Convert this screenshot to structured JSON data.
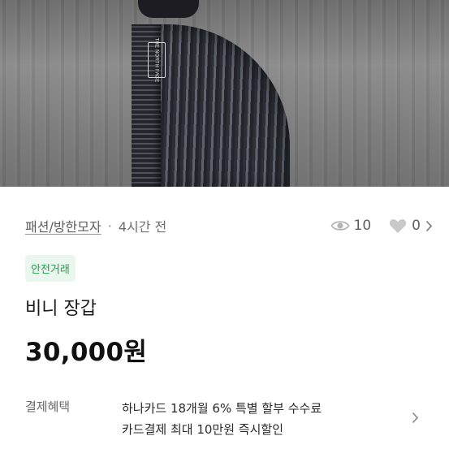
{
  "photo": {
    "logo_text": "THE NORTH FACE"
  },
  "meta": {
    "category": "패션/방한모자",
    "separator": "·",
    "time_ago": "4시간 전",
    "views": "10",
    "likes": "0",
    "icons": {
      "views": "eye-icon",
      "likes": "heart-icon",
      "more": "chevron-right-icon"
    }
  },
  "badge": {
    "label": "안전거래",
    "bg_color": "#eaf7ee",
    "text_color": "#1f9d4d"
  },
  "product": {
    "title": "비니 장갑",
    "price": "30,000원"
  },
  "benefit": {
    "label": "결제혜택",
    "lines": [
      "하나카드 18개월 6% 특별 할부 수수료",
      "카드결제 최대 10만원 즉시할인"
    ]
  }
}
